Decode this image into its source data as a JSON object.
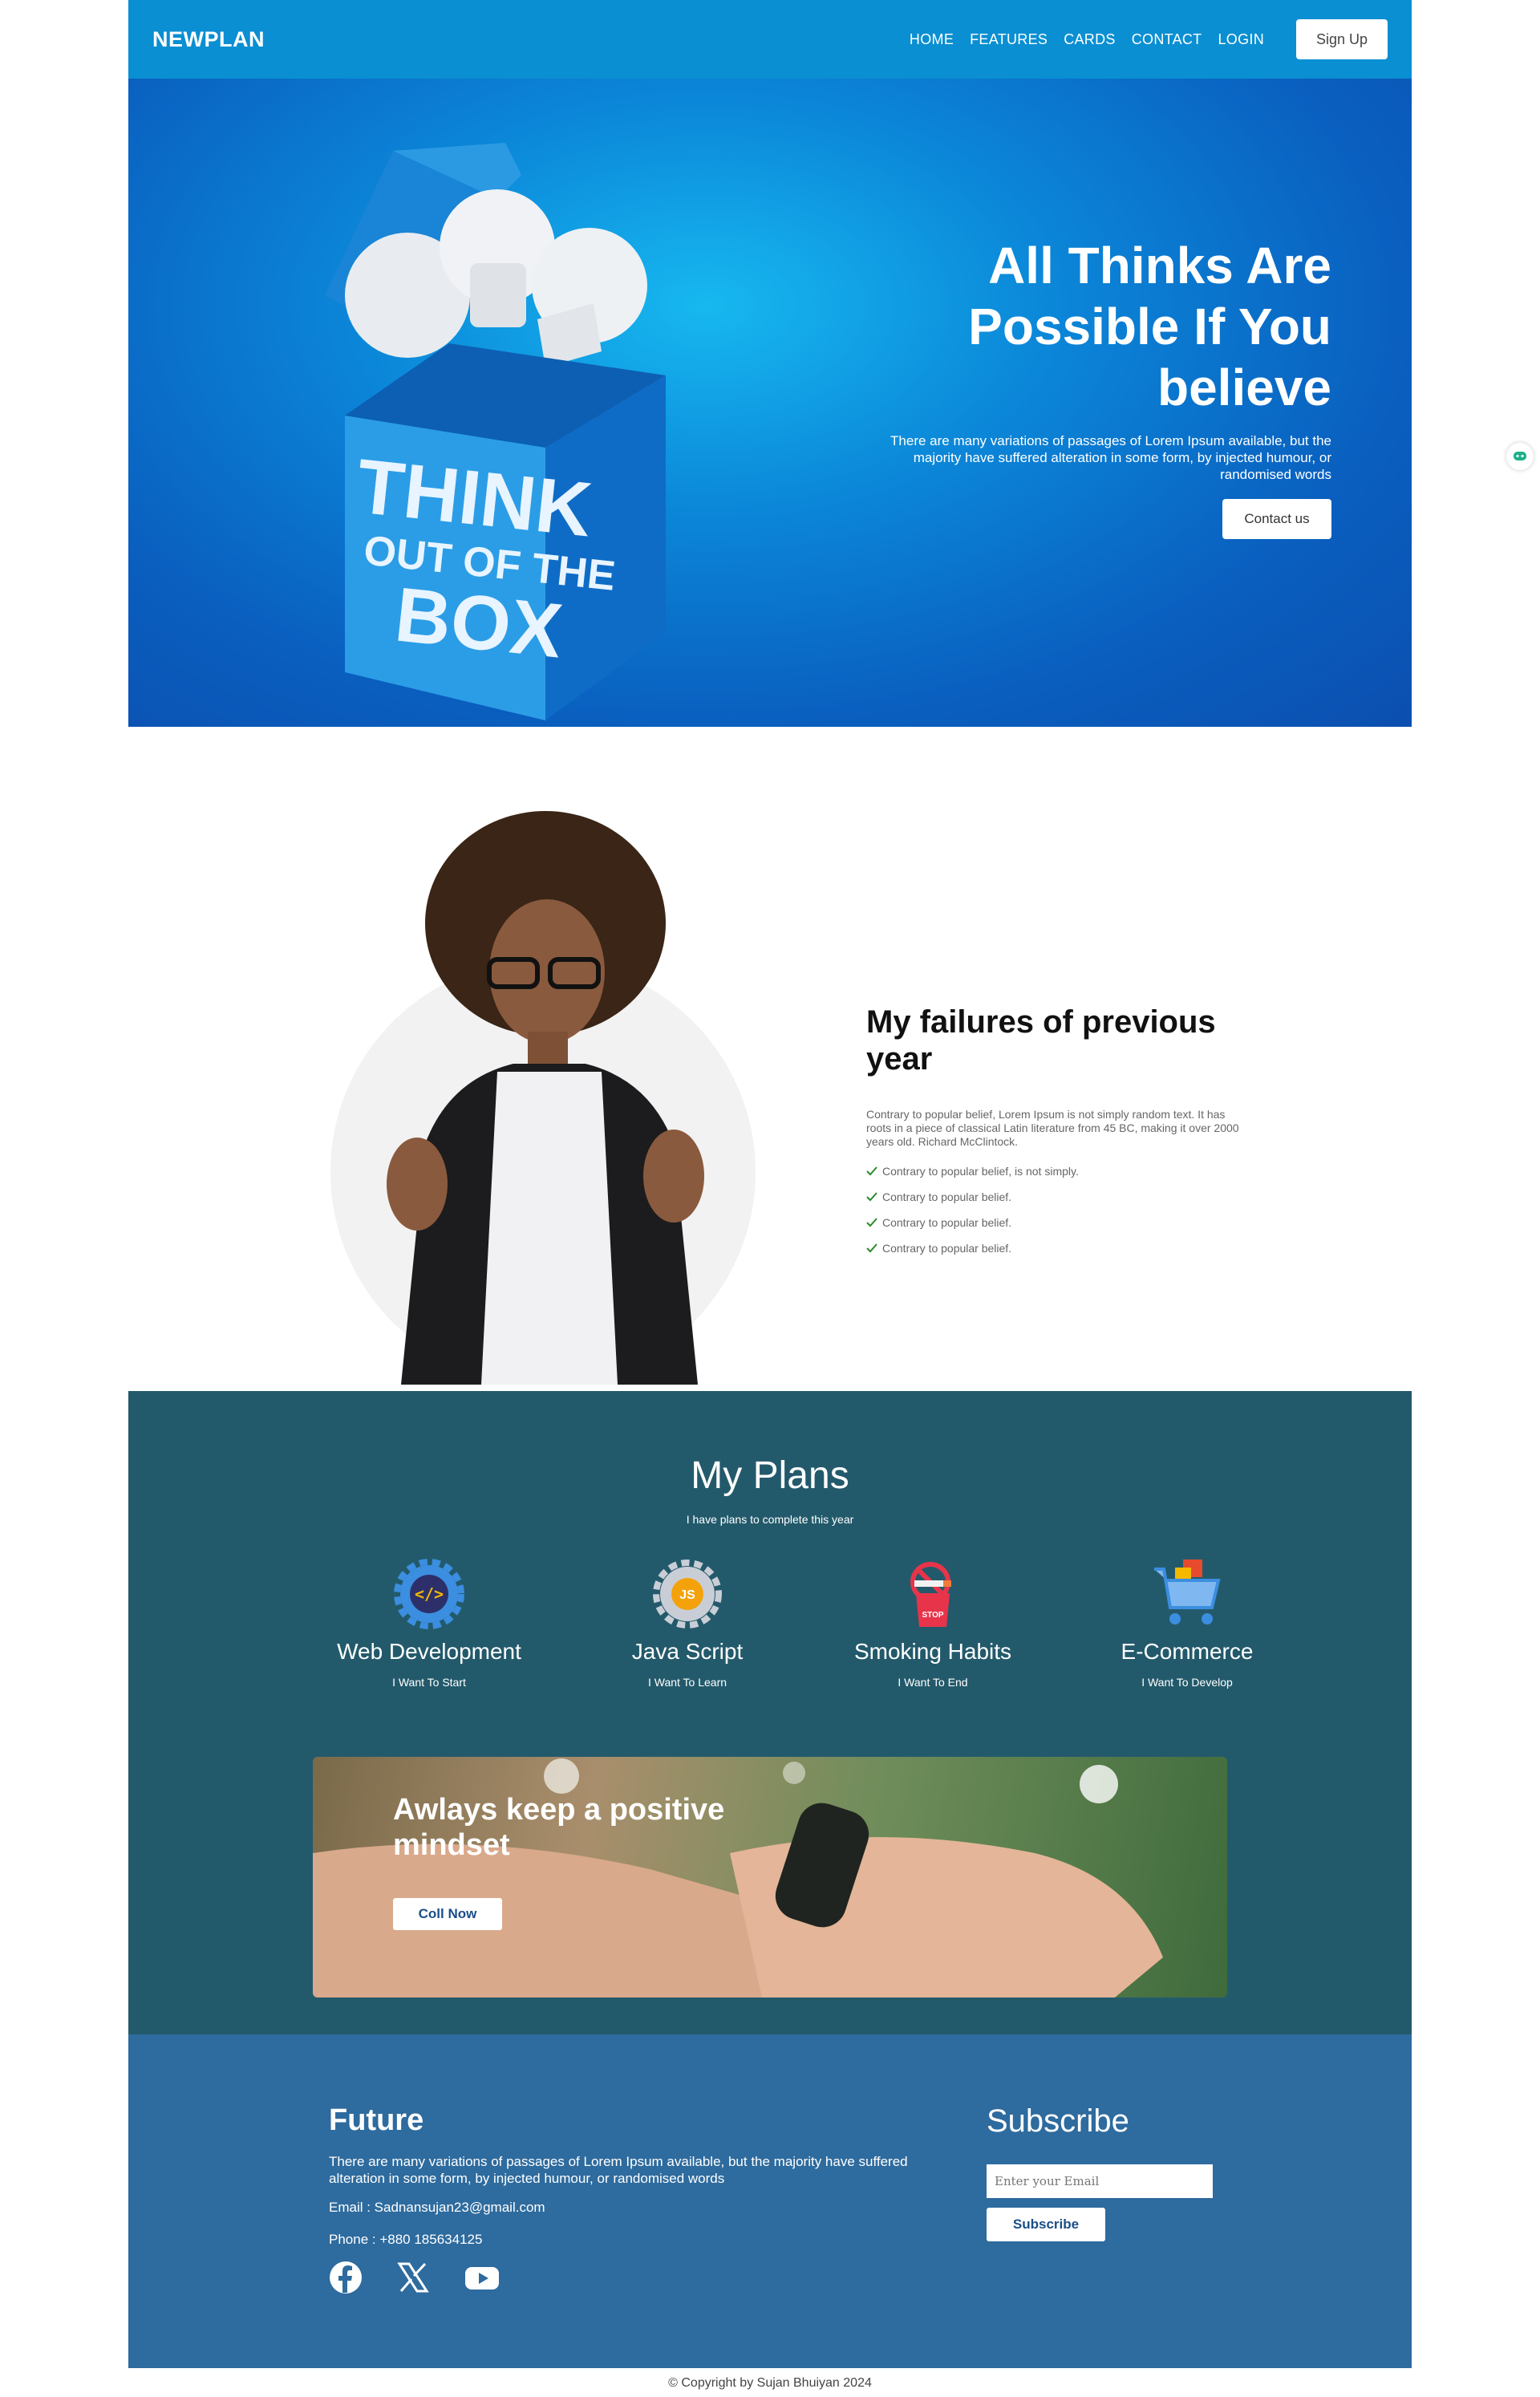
{
  "nav": {
    "brand": "NEWPLAN",
    "links": [
      "HOME",
      "FEATURES",
      "CARDS",
      "CONTACT",
      "LOGIN"
    ],
    "signup": "Sign Up"
  },
  "hero": {
    "title": "All Thinks Are Possible If You believe",
    "subtitle": "There are many variations of passages of Lorem Ipsum available, but the majority have suffered alteration in some form, by injected humour, or randomised words",
    "button": "Contact us",
    "box_lines": [
      "THINK",
      "OUT OF THE",
      "BOX"
    ]
  },
  "failures": {
    "title": "My failures of previous year",
    "paragraph": "Contrary to popular belief, Lorem Ipsum is not simply random text. It has roots in a piece of classical Latin literature from 45 BC, making it over 2000 years old. Richard McClintock.",
    "checks": [
      "Contrary to popular belief, is not simply.",
      "Contrary to popular belief.",
      "Contrary to popular belief.",
      "Contrary to popular belief."
    ]
  },
  "plans": {
    "title": "My Plans",
    "subtitle": "I have plans to complete this year",
    "items": [
      {
        "name": "Web Development",
        "desc": "I Want To Start",
        "icon": "code-gear-icon"
      },
      {
        "name": "Java Script",
        "desc": "I Want To Learn",
        "icon": "js-gear-icon"
      },
      {
        "name": "Smoking Habits",
        "desc": "I Want To End",
        "icon": "no-smoking-icon"
      },
      {
        "name": "E-Commerce",
        "desc": "I Want To Develop",
        "icon": "shopping-cart-icon"
      }
    ],
    "banner": {
      "title": "Awlays keep a positive mindset",
      "button": "Coll Now"
    }
  },
  "footer": {
    "future_title": "Future",
    "future_text": "There are many variations of passages of Lorem Ipsum available, but the majority have suffered alteration in some form, by injected humour, or randomised words",
    "email": "Email : Sadnansujan23@gmail.com",
    "phone": "Phone : +880 185634125",
    "subscribe_title": "Subscribe",
    "email_placeholder": "Enter your Email",
    "subscribe_button": "Subscribe",
    "copyright": "Copyright by Sujan Bhuiyan 2024"
  },
  "colors": {
    "nav": "#0a8fd2",
    "plans_bg": "#235a6b",
    "footer_bg": "#2e6b9e",
    "check": "#2a8a2a"
  }
}
